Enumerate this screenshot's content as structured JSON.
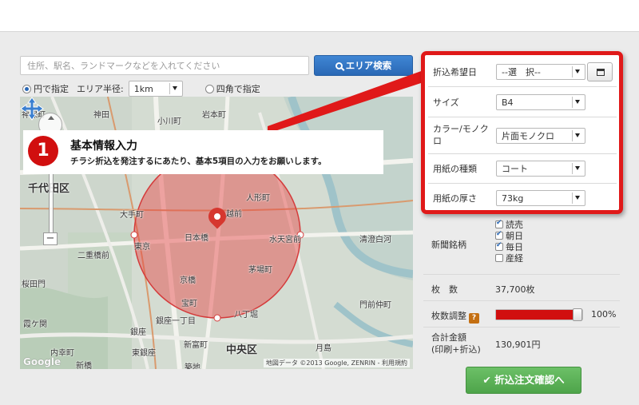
{
  "search": {
    "placeholder": "住所、駅名、ランドマークなどを入れてください",
    "button_label": "エリア検索"
  },
  "area_mode": {
    "circle_label": "円で指定",
    "radius_label": "エリア半径:",
    "radius_value": "1km",
    "square_label": "四角で指定",
    "selected": "circle"
  },
  "map": {
    "labels": {
      "kanda": "神田",
      "kanda_jinbocho": "神保町",
      "ogawamachi": "小川町",
      "iwamotocho": "岩本町",
      "chiyoda_ku": "千代田区",
      "ningyocho": "人形町",
      "otemachi": "大手町",
      "mitsukoshimae": "越前",
      "nihonbashi": "日本橋",
      "suitengumae": "水天宮前",
      "tokyo": "東京",
      "nijubashimae": "二重橋前",
      "seishin_shirakawa": "清澄白河",
      "kayabacho": "茅場町",
      "sakuradamon": "桜田門",
      "kyobashi": "京橋",
      "takaracho": "宝町",
      "hatchobori": "八丁堀",
      "ginza_itchome": "銀座一丁目",
      "kasumigaseki": "霞ケ関",
      "ginza": "銀座",
      "shintomicho": "新富町",
      "uchisaiwaicho": "内幸町",
      "higashi_ginza": "東銀座",
      "chuo_ku": "中央区",
      "shinbashi": "新橋",
      "tsukishima": "月島",
      "monzen_nakacho": "門前仲町",
      "tsukiji": "築地"
    },
    "copyright": "地図データ ©2013 Google, ZENRIN - 利用規約",
    "google_logo": "Google"
  },
  "callout": {
    "number": "1",
    "title": "基本情報入力",
    "description": "チラシ折込を発注するにあたり、基本5項目の入力をお願いします。"
  },
  "form": {
    "desired_date_label": "折込希望日",
    "desired_date_value": "--選　択--",
    "size_label": "サイズ",
    "size_value": "B4",
    "color_label": "カラー/モノクロ",
    "color_value": "片面モノクロ",
    "paper_type_label": "用紙の種類",
    "paper_type_value": "コート",
    "paper_thickness_label": "用紙の厚さ",
    "paper_thickness_value": "73kg"
  },
  "newspapers": {
    "label": "新聞銘柄",
    "items": [
      {
        "name": "読売",
        "checked": true
      },
      {
        "name": "朝日",
        "checked": true
      },
      {
        "name": "毎日",
        "checked": true
      },
      {
        "name": "産経",
        "checked": false
      }
    ]
  },
  "summary": {
    "count_label": "枚　数",
    "count_value": "37,700枚",
    "adjust_label": "枚数調整",
    "help_glyph": "?",
    "adjust_percent": 100,
    "adjust_value": "100%",
    "total_label_line1": "合計金額",
    "total_label_line2": "(印刷+折込)",
    "total_value": "130,901円"
  },
  "confirm_button_label": "折込注文確認へ",
  "colors": {
    "accent_red": "#e01919",
    "search_blue": "#2a68b5",
    "confirm_green": "#4ea44a"
  }
}
